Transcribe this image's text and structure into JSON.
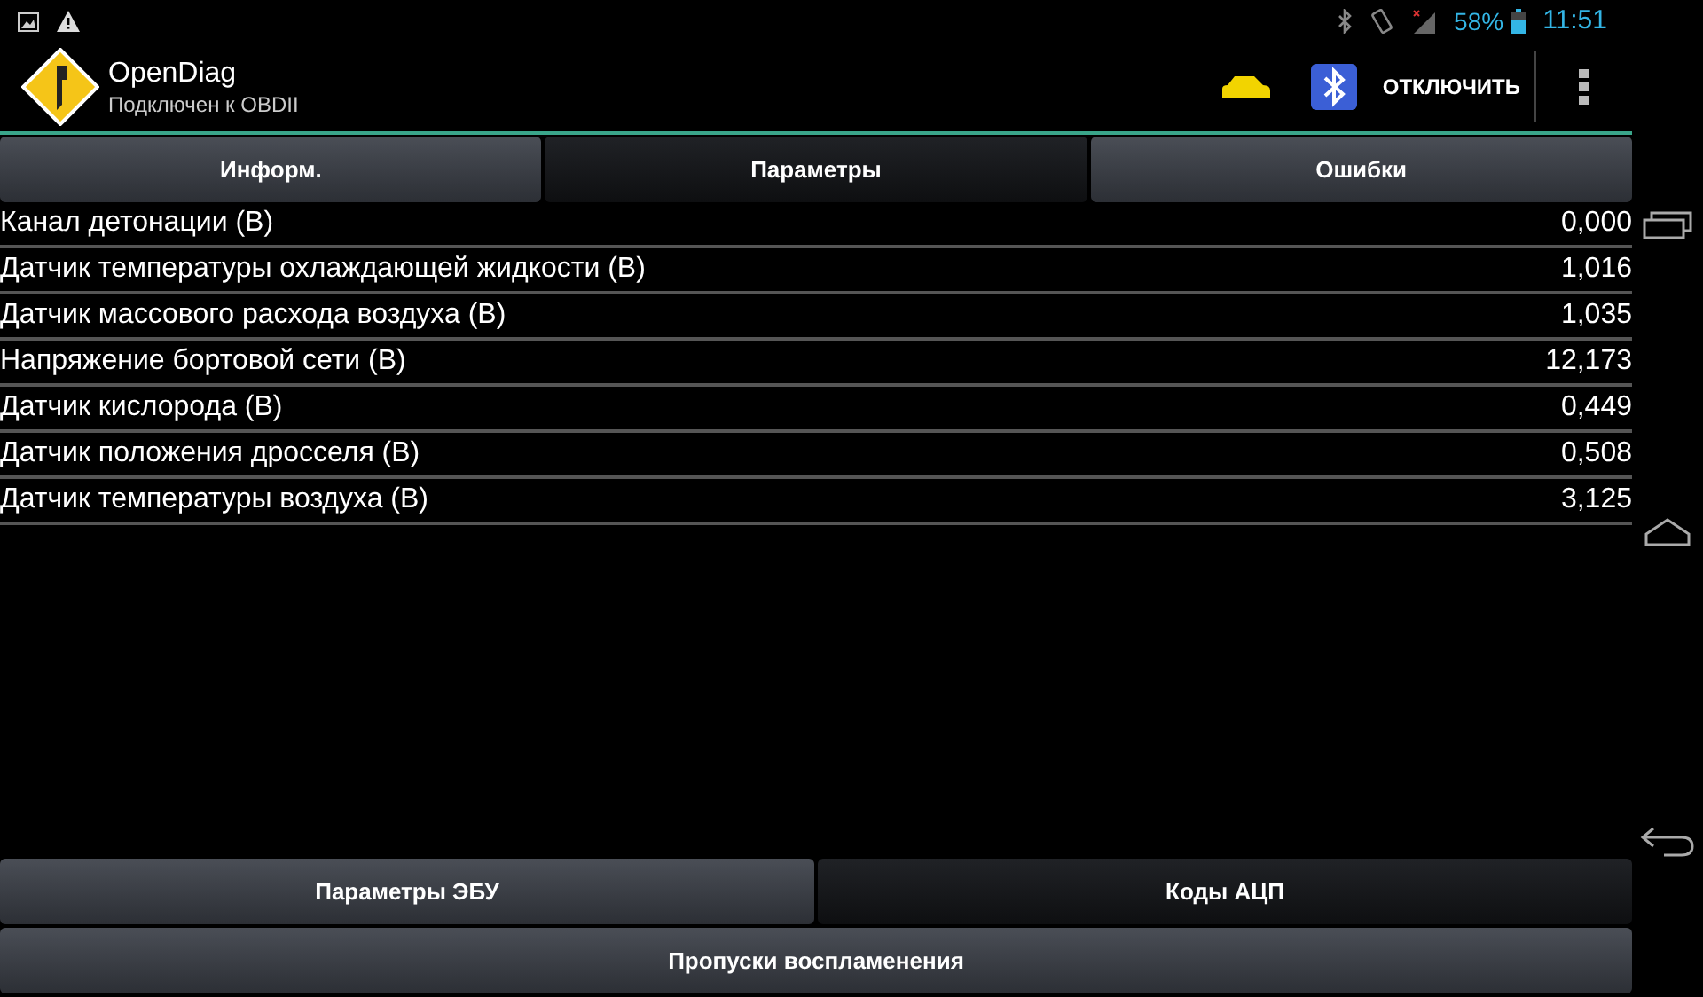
{
  "status_bar": {
    "battery": "58%",
    "time": "11:51"
  },
  "action_bar": {
    "title": "OpenDiag",
    "subtitle": "Подключен к OBDII",
    "disconnect": "ОТКЛЮЧИТЬ"
  },
  "tabs": [
    {
      "label": "Информ.",
      "selected": false
    },
    {
      "label": "Параметры",
      "selected": true
    },
    {
      "label": "Ошибки",
      "selected": false
    }
  ],
  "parameters": [
    {
      "name": "Канал детонации (В)",
      "value": "0,000"
    },
    {
      "name": "Датчик температуры охлаждающей жидкости (В)",
      "value": "1,016"
    },
    {
      "name": "Датчик массового расхода воздуха (В)",
      "value": "1,035"
    },
    {
      "name": "Напряжение бортовой сети (В)",
      "value": "12,173"
    },
    {
      "name": "Датчик кислорода (В)",
      "value": "0,449"
    },
    {
      "name": "Датчик положения дросселя (В)",
      "value": "0,508"
    },
    {
      "name": "Датчик температуры воздуха (В)",
      "value": "3,125"
    }
  ],
  "bottom_tabs": [
    {
      "label": "Параметры ЭБУ",
      "selected": false
    },
    {
      "label": "Коды АЦП",
      "selected": true
    }
  ],
  "bottom_button": "Пропуски воспламенения"
}
